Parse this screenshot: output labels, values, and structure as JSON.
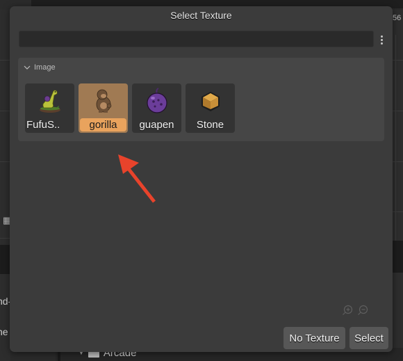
{
  "dialog": {
    "title": "Select Texture",
    "search": {
      "value": "",
      "placeholder": ""
    },
    "more_icon": "kebab-menu-icon",
    "group": {
      "label": "Image",
      "expanded": true,
      "items": [
        {
          "label": "FufuS..",
          "icon": "dinosaur-sprite",
          "selected": false
        },
        {
          "label": "gorilla",
          "icon": "gorilla-sprite",
          "selected": true
        },
        {
          "label": "guapen",
          "icon": "purple-fruit-sprite",
          "selected": false
        },
        {
          "label": "Stone",
          "icon": "stone-block-sprite",
          "selected": false
        }
      ]
    },
    "zoom_in_icon": "zoom-in-icon",
    "zoom_out_icon": "zoom-out-icon",
    "buttons": {
      "no_texture": "No Texture",
      "select": "Select"
    }
  },
  "annotation": {
    "type": "arrow",
    "color": "#e8432b",
    "points_to": "gorilla"
  },
  "background": {
    "right_number": "56",
    "left_texts": [
      "nd-",
      "ne"
    ],
    "tree_item": "Arcade"
  },
  "colors": {
    "dialog_bg": "#3b3b3b",
    "selected_item_bg": "#a07a53",
    "selected_label_bg": "#e9a35d",
    "button_bg": "#575757"
  }
}
